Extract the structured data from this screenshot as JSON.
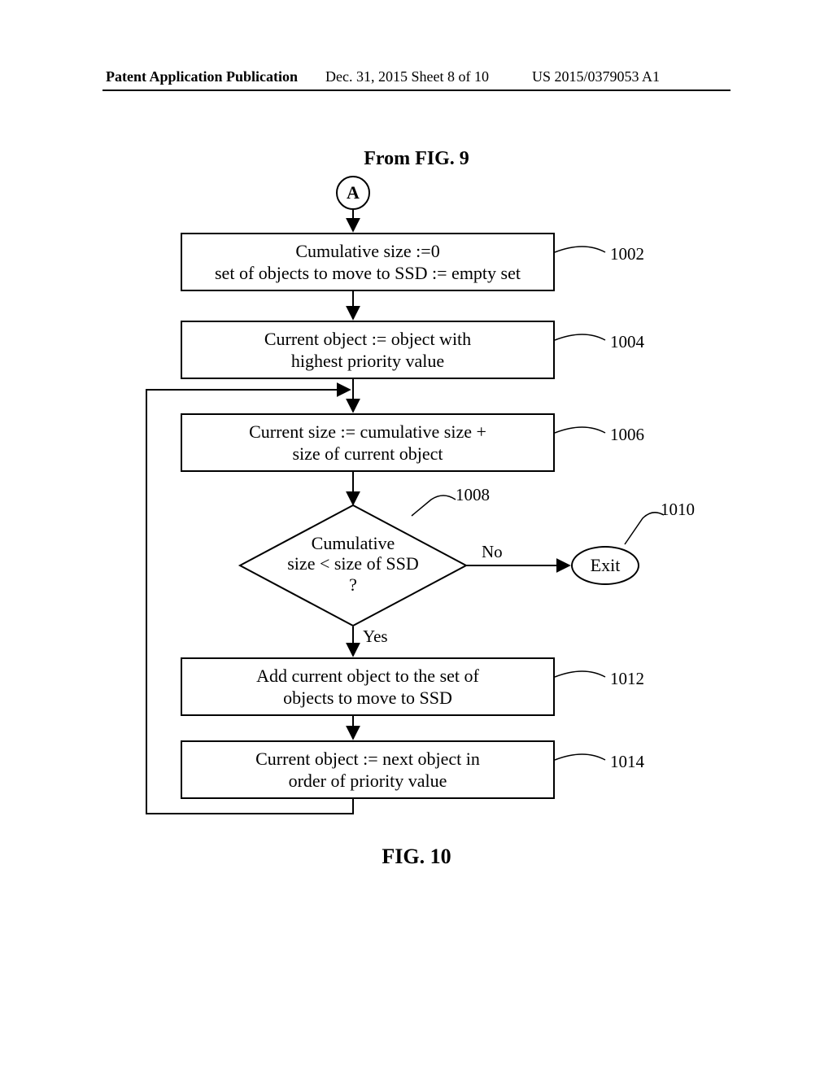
{
  "header": {
    "left": "Patent Application Publication",
    "mid": "Dec. 31, 2015  Sheet 8 of 10",
    "right": "US 2015/0379053 A1"
  },
  "figure": {
    "from": "From FIG. 9",
    "connector": "A",
    "caption": "FIG. 10"
  },
  "steps": {
    "s1002": {
      "l1": "Cumulative size :=0",
      "l2": "set of objects to move to SSD := empty set"
    },
    "s1004": {
      "l1": "Current object := object with",
      "l2": "highest priority value"
    },
    "s1006": {
      "l1": "Current size := cumulative size +",
      "l2": "size of current object"
    },
    "s1008": {
      "l1": "Cumulative",
      "l2": "size < size of SSD",
      "l3": "?"
    },
    "s1012": {
      "l1": "Add current object to the set of",
      "l2": "objects to move to SSD"
    },
    "s1014": {
      "l1": "Current object := next object in",
      "l2": "order of priority value"
    }
  },
  "labels": {
    "yes": "Yes",
    "no": "No",
    "exit": "Exit"
  },
  "refs": {
    "r1002": "1002",
    "r1004": "1004",
    "r1006": "1006",
    "r1008": "1008",
    "r1010": "1010",
    "r1012": "1012",
    "r1014": "1014"
  }
}
